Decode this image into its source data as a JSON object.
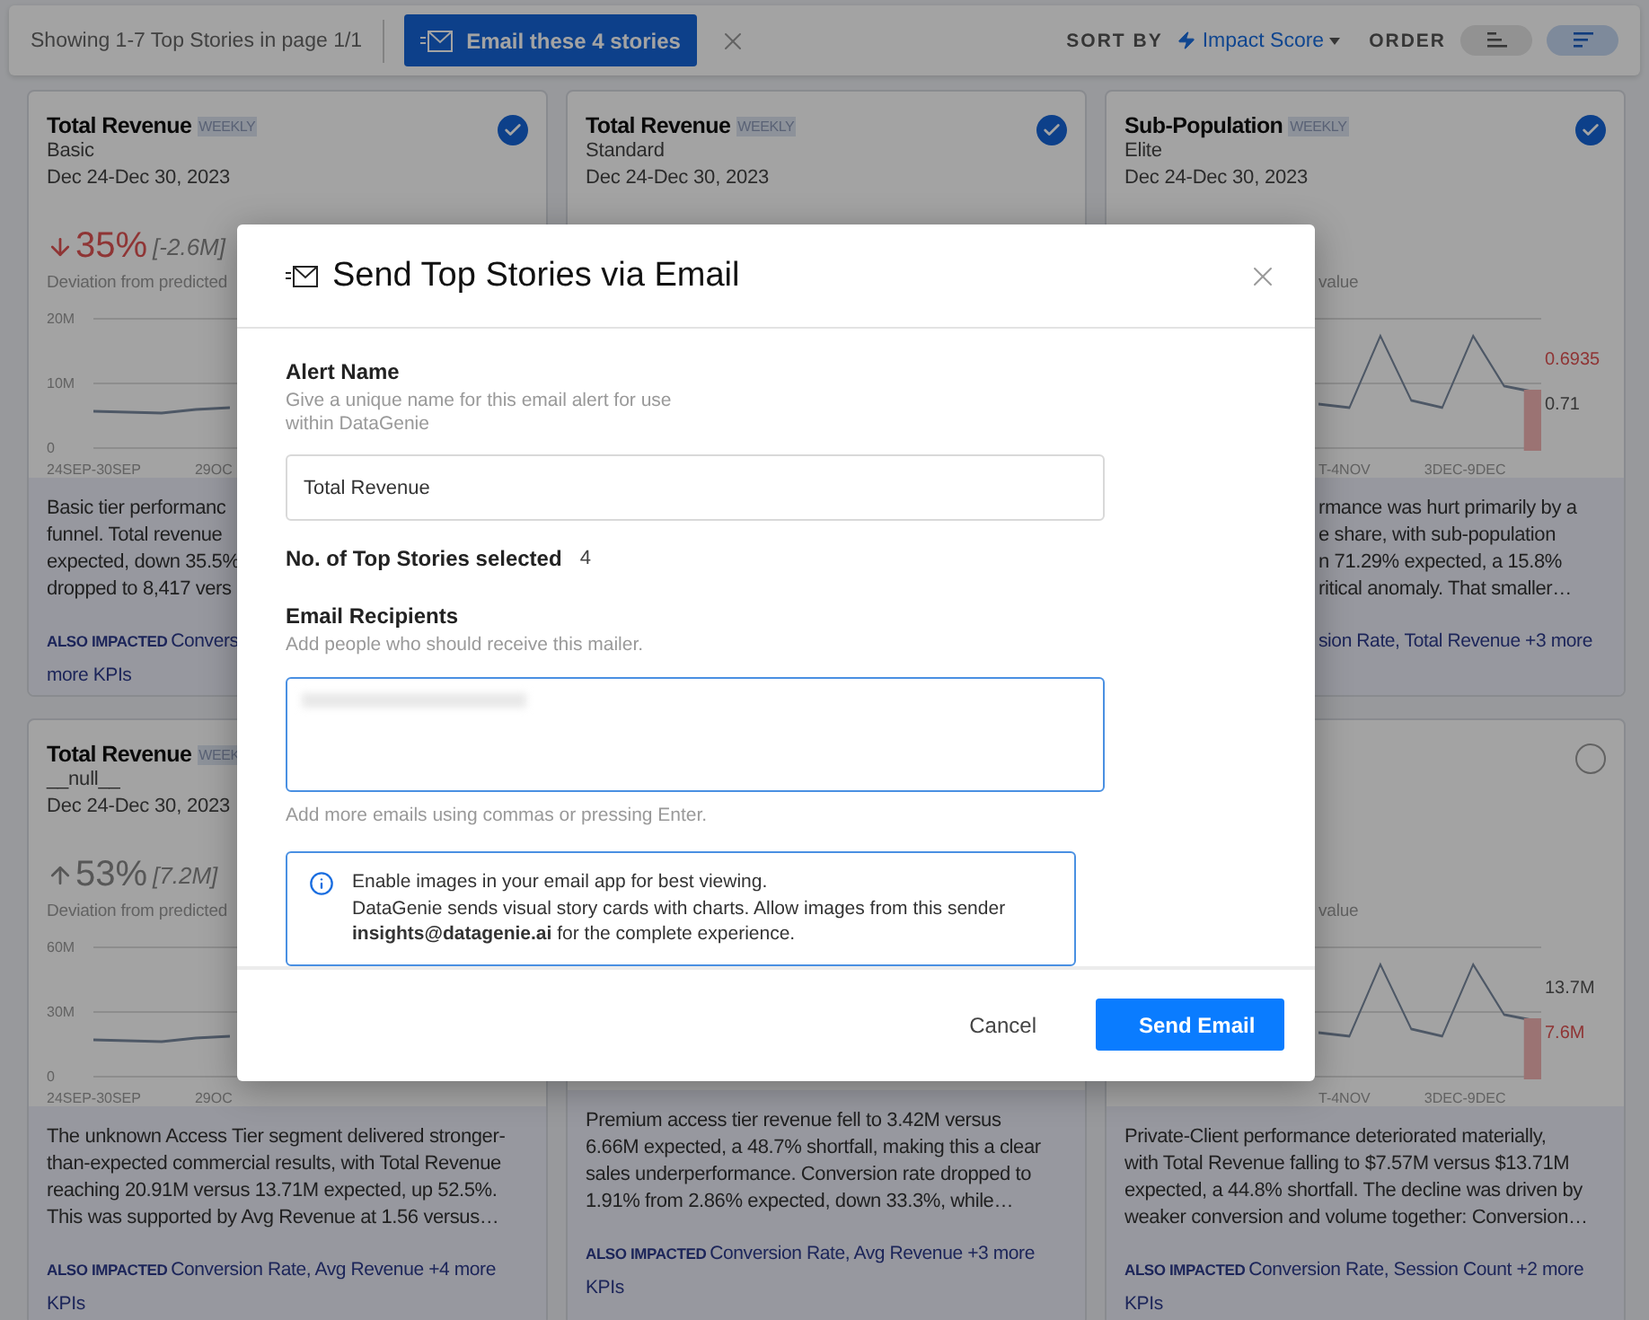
{
  "toolbar": {
    "summary": "Showing 1-7 Top Stories in page 1/1",
    "email_button": "Email these 4 stories",
    "sort_label": "SORT BY",
    "sort_value": "Impact Score",
    "order_label": "ORDER",
    "order_options": [
      {
        "kind": "ascending",
        "selected": false
      },
      {
        "kind": "descending",
        "selected": true
      }
    ]
  },
  "cards": [
    {
      "kind": "head",
      "title": "Total Revenue",
      "badge": "WEEKLY",
      "segment": "Basic",
      "date": "Dec 24-Dec 30, 2023",
      "checked": true,
      "metric": {
        "falling": true,
        "value": "35%",
        "delta": "[-2.6M]"
      },
      "deviation": "Deviation from predicted",
      "chart": {
        "yticks": [
          "20M",
          "10M",
          "0"
        ],
        "xlabels": [
          "24SEP-30SEP",
          "29OC"
        ]
      },
      "summary": {
        "kind": "head",
        "lines": [
          "Basic tier performanc",
          "funnel. Total revenue",
          "expected, down 35.5%",
          "dropped to 8,417 vers"
        ]
      },
      "impacted": {
        "label": "ALSO IMPACTED",
        "lines": [
          "Convers",
          "more KPIs"
        ]
      }
    },
    {
      "kind": "full",
      "title": "Total Revenue",
      "badge": "WEEKLY",
      "segment": "Standard",
      "date": "Dec 24-Dec 30, 2023",
      "checked": true
    },
    {
      "kind": "tail",
      "title": "Sub-Population",
      "badge": "WEEKLY",
      "segment": "Elite",
      "date": "Dec 24-Dec 30, 2023",
      "checked": true,
      "deviation": "value",
      "chart": {
        "xlabels": [
          "T-4NOV",
          "3DEC-9DEC"
        ],
        "markers": [
          {
            "kind": "actual",
            "text": "0.6935"
          },
          {
            "kind": "predicted",
            "text": "0.71"
          }
        ]
      },
      "summary": {
        "kind": "tail",
        "lines": [
          "rmance was hurt primarily by a",
          "e share, with sub-population",
          "n 71.29% expected, a 15.8%",
          "ritical anomaly. That smaller…"
        ]
      },
      "impacted": {
        "lines": [
          "sion Rate, Total Revenue +3 more"
        ]
      }
    },
    {
      "kind": "head",
      "title": "Total Revenue",
      "badge": "WEEK",
      "segment": "__null__",
      "date": "Dec 24-Dec 30, 2023",
      "metric": {
        "falling": false,
        "value": "53%",
        "delta": "[7.2M]"
      },
      "deviation": "Deviation from predicted",
      "chart": {
        "yticks": [
          "60M",
          "30M",
          "0"
        ],
        "xlabels": [
          "24SEP-30SEP",
          "29OC"
        ]
      },
      "summary": {
        "kind": "full",
        "lines": [
          "The unknown Access Tier segment delivered stronger-",
          "than-expected commercial results, with Total Revenue",
          "reaching 20.91M versus 13.71M expected, up 52.5%.",
          "This was supported by Avg Revenue at 1.56 versus…"
        ]
      },
      "impacted": {
        "label": "ALSO IMPACTED",
        "lines": [
          "Conversion Rate, Avg Revenue +4 more",
          "KPIs"
        ]
      }
    },
    {
      "kind": "full",
      "summary": {
        "kind": "full",
        "lines": [
          "Premium access tier revenue fell to 3.42M versus",
          "6.66M expected, a 48.7% shortfall, making this a clear",
          "sales underperformance. Conversion rate dropped to",
          "1.91% from 2.86% expected, down 33.3%, while…"
        ]
      },
      "impacted": {
        "label": "ALSO IMPACTED",
        "lines": [
          "Conversion Rate, Avg Revenue +3 more",
          "KPIs"
        ]
      }
    },
    {
      "kind": "tail",
      "checked": false,
      "deviation": "value",
      "chart": {
        "xlabels": [
          "T-4NOV",
          "3DEC-9DEC"
        ],
        "markers": [
          {
            "kind": "predicted",
            "text": "13.7M"
          },
          {
            "kind": "actual",
            "text": "7.6M"
          }
        ]
      },
      "summary": {
        "kind": "full",
        "lines": [
          "Private-Client performance deteriorated materially,",
          "with Total Revenue falling to $7.57M versus $13.71M",
          "expected, a 44.8% shortfall. The decline was driven by",
          "weaker conversion and volume together: Conversion…"
        ]
      },
      "impacted": {
        "label": "ALSO IMPACTED",
        "lines": [
          "Conversion Rate, Session Count +2 more",
          "KPIs"
        ]
      }
    }
  ],
  "modal": {
    "title": "Send Top Stories via Email",
    "alert_name": {
      "label": "Alert Name",
      "help": "Give a unique name for this email alert for use within DataGenie",
      "value": "Total Revenue"
    },
    "stories_count": {
      "label": "No. of Top Stories selected",
      "value": "4"
    },
    "recipients": {
      "label": "Email Recipients",
      "help": "Add people who should receive this mailer.",
      "hint": "Add more emails using commas or pressing Enter."
    },
    "notice": {
      "heading": "Enable images in your email app for best viewing.",
      "text": "DataGenie sends visual story cards with charts. Allow images from this sender **insights@datagenie.ai** for the complete experience."
    },
    "buttons": [
      {
        "kind": "secondary",
        "label": "Cancel"
      },
      {
        "kind": "primary",
        "label": "Send Email"
      }
    ]
  }
}
